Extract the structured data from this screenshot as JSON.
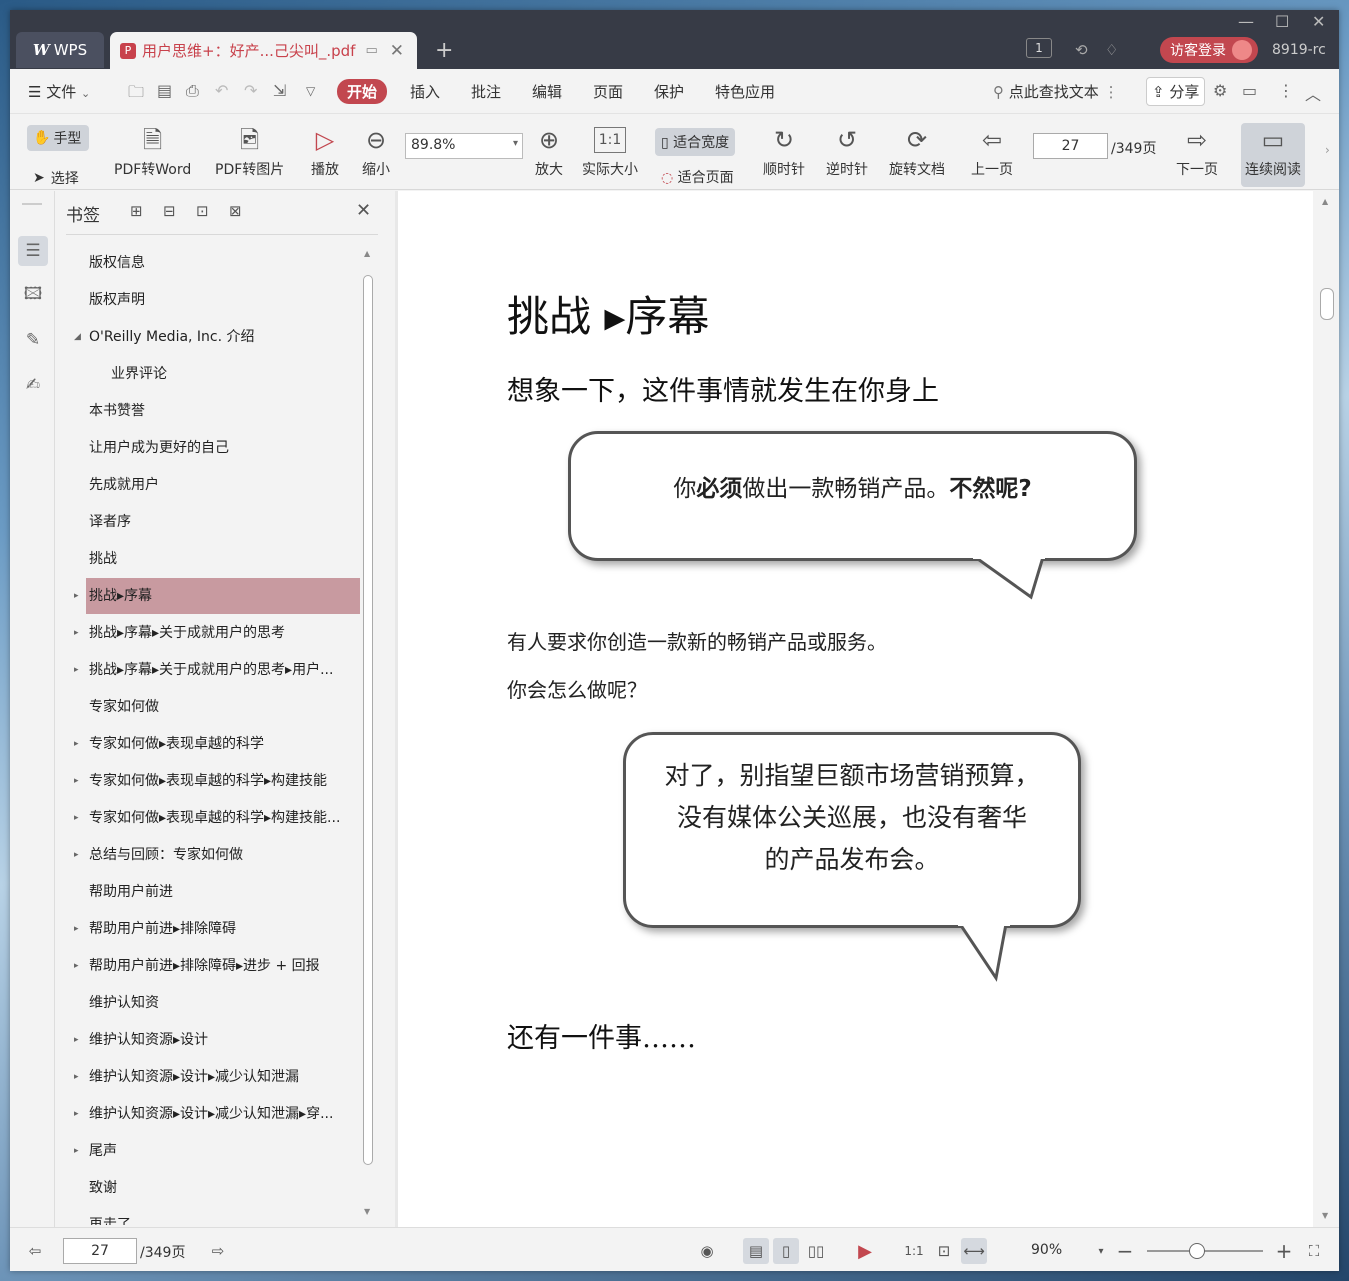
{
  "app": {
    "wps_tab": "WPS",
    "doc_tab": "用户思维+：好产...己尖叫_.pdf",
    "badge_number": "1",
    "login_label": "访客登录",
    "user_name": "8919-rc"
  },
  "menu": {
    "file": "文件",
    "items": [
      "开始",
      "插入",
      "批注",
      "编辑",
      "页面",
      "保护",
      "特色应用"
    ],
    "search_label": "点此查找文本",
    "share_label": "分享"
  },
  "ribbon": {
    "hand": "手型",
    "select": "选择",
    "pdf_to_word": "PDF转Word",
    "pdf_to_image": "PDF转图片",
    "play": "播放",
    "zoom_out": "缩小",
    "zoom_value": "89.8%",
    "zoom_in": "放大",
    "actual_size": "实际大小",
    "fit_width": "适合宽度",
    "fit_page": "适合页面",
    "clockwise": "顺时针",
    "counter_clockwise": "逆时针",
    "rotate_doc": "旋转文档",
    "prev_page": "上一页",
    "page_current": "27",
    "page_total": "/349页",
    "next_page": "下一页",
    "continuous": "连续阅读"
  },
  "bookmarks": {
    "title": "书签",
    "items": [
      {
        "label": "版权信息"
      },
      {
        "label": "版权声明"
      },
      {
        "label": "O'Reilly Media, Inc. 介绍"
      },
      {
        "label": "业界评论"
      },
      {
        "label": "本书赞誉"
      },
      {
        "label": "让用户成为更好的自己"
      },
      {
        "label": "先成就用户"
      },
      {
        "label": "译者序"
      },
      {
        "label": "挑战"
      },
      {
        "label": "挑战▸序幕"
      },
      {
        "label": "挑战▸序幕▸关于成就用户的思考"
      },
      {
        "label": "挑战▸序幕▸关于成就用户的思考▸用户..."
      },
      {
        "label": "专家如何做"
      },
      {
        "label": "专家如何做▸表现卓越的科学"
      },
      {
        "label": "专家如何做▸表现卓越的科学▸构建技能"
      },
      {
        "label": "专家如何做▸表现卓越的科学▸构建技能..."
      },
      {
        "label": "总结与回顾：专家如何做"
      },
      {
        "label": "帮助用户前进"
      },
      {
        "label": "帮助用户前进▸排除障碍"
      },
      {
        "label": "帮助用户前进▸排除障碍▸进步 + 回报"
      },
      {
        "label": "维护认知资"
      },
      {
        "label": "维护认知资源▸设计"
      },
      {
        "label": "维护认知资源▸设计▸减少认知泄漏"
      },
      {
        "label": "维护认知资源▸设计▸减少认知泄漏▸穿..."
      },
      {
        "label": "尾声"
      },
      {
        "label": "致谢"
      },
      {
        "label": "再走了"
      }
    ]
  },
  "page": {
    "heading": "挑战 ▸序幕",
    "subheading": "想象一下，这件事情就发生在你身上",
    "bubble1_pre": "你",
    "bubble1_bold1": "必须",
    "bubble1_mid": "做出一款畅销产品。",
    "bubble1_bold2": "不然呢?",
    "para1": "有人要求你创造一款新的畅销产品或服务。",
    "para2": "你会怎么做呢？",
    "bubble2_line1": "对了，别指望巨额市场营销预算，",
    "bubble2_line2": "没有媒体公关巡展，也没有奢华",
    "bubble2_line3": "的产品发布会。",
    "heading3": "还有一件事……"
  },
  "status": {
    "page_current": "27",
    "page_total": "/349页",
    "zoom": "90%"
  },
  "colors": {
    "accent": "#c2474f",
    "titlebar": "#373b46",
    "bookmark_selected": "#c89aa0"
  }
}
